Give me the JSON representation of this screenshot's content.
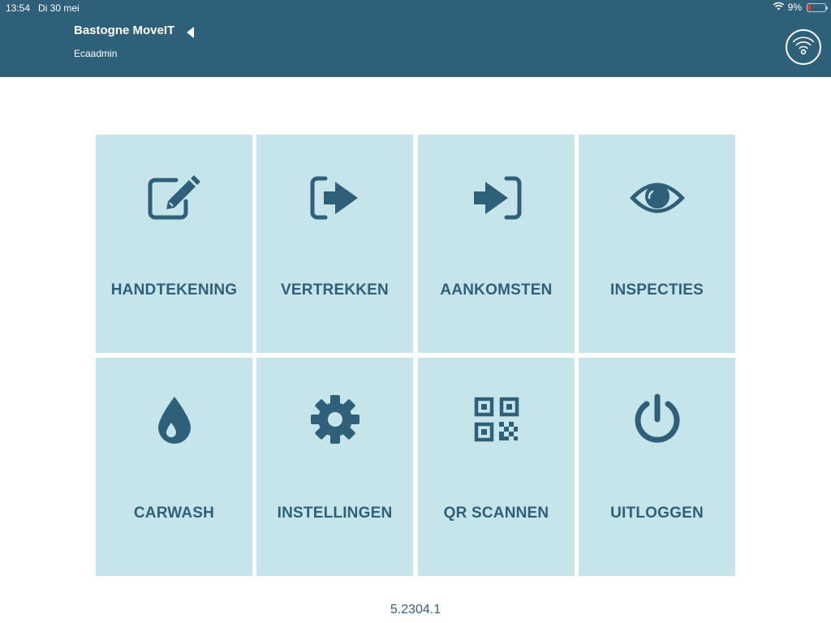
{
  "statusbar": {
    "time": "13:54",
    "date": "Di 30 mei",
    "battery_percent": "9%",
    "battery_level": 0.09,
    "icons": [
      "wifi-icon",
      "battery-icon"
    ]
  },
  "header": {
    "title": "Bastogne MoveIT",
    "user": "Ecaadmin",
    "back_icon": "triangle-left-icon",
    "sync_icon": "wifi-sync-icon"
  },
  "tiles": [
    {
      "label": "HANDTEKENING",
      "icon": "signature-edit-icon"
    },
    {
      "label": "VERTREKKEN",
      "icon": "sign-out-icon"
    },
    {
      "label": "AANKOMSTEN",
      "icon": "sign-in-icon"
    },
    {
      "label": "INSPECTIES",
      "icon": "eye-icon"
    },
    {
      "label": "CARWASH",
      "icon": "water-drop-icon"
    },
    {
      "label": "INSTELLINGEN",
      "icon": "gear-icon"
    },
    {
      "label": "QR SCANNEN",
      "icon": "qr-code-icon"
    },
    {
      "label": "UITLOGGEN",
      "icon": "power-icon"
    }
  ],
  "footer": {
    "version": "5.2304.1"
  },
  "colors": {
    "header_bg": "#2e6179",
    "tile_bg": "#c5e5eb",
    "accent": "#2e6179",
    "battery_low": "#e53935"
  }
}
